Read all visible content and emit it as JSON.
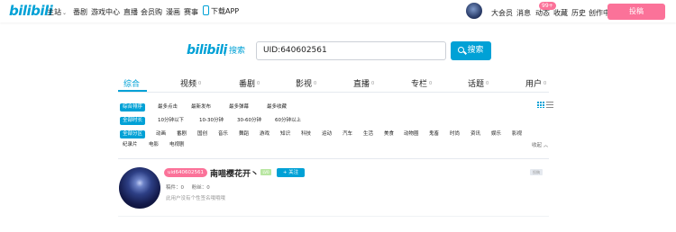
{
  "header": {
    "logo": "bilibili",
    "nav": [
      {
        "label": "主站",
        "has_chevron": true
      },
      {
        "label": "番剧"
      },
      {
        "label": "游戏中心"
      },
      {
        "label": "直播"
      },
      {
        "label": "会员购"
      },
      {
        "label": "漫画"
      },
      {
        "label": "赛事"
      },
      {
        "label": "下载APP"
      }
    ],
    "right": [
      {
        "label": "大会员"
      },
      {
        "label": "消息"
      },
      {
        "label": "动态"
      },
      {
        "label": "收藏"
      },
      {
        "label": "历史"
      },
      {
        "label": "创作中心"
      }
    ],
    "dynamic_badge": "99+",
    "upload_label": "投稿"
  },
  "search": {
    "logo": "bilibili",
    "logo_sub": "搜索",
    "query": "UID:640602561",
    "button_label": "搜索"
  },
  "tabs": [
    {
      "label": "综合",
      "count": "",
      "active": true
    },
    {
      "label": "视频",
      "count": "0"
    },
    {
      "label": "番剧",
      "count": "0"
    },
    {
      "label": "影视",
      "count": "0"
    },
    {
      "label": "直播",
      "count": "0"
    },
    {
      "label": "专栏",
      "count": "0"
    },
    {
      "label": "话题",
      "count": "0"
    },
    {
      "label": "用户",
      "count": "0"
    }
  ],
  "filters": {
    "order": [
      "综合排序",
      "最多点击",
      "最新发布",
      "最多弹幕",
      "最多收藏"
    ],
    "duration": [
      "全部时长",
      "10分钟以下",
      "10-30分钟",
      "30-60分钟",
      "60分钟以上"
    ],
    "zones_row1": [
      "全部分区",
      "动画",
      "番剧",
      "国创",
      "音乐",
      "舞蹈",
      "游戏",
      "知识",
      "科技",
      "运动",
      "汽车",
      "生活",
      "美食",
      "动物圈",
      "鬼畜",
      "时尚",
      "资讯",
      "娱乐",
      "影视"
    ],
    "zones_row2": [
      "纪录片",
      "电影",
      "电视剧"
    ],
    "collapse_label": "收起"
  },
  "result": {
    "uid_tag": "uid640602561",
    "name": "南喵樱花开丶",
    "level": "LV0",
    "follow_label": "+ 关注",
    "stats": [
      "稿件：0",
      "粉丝：0"
    ],
    "sign": "此用户没有个性签名哦哦哦",
    "corner_label": "投稿"
  },
  "colors": {
    "accent": "#00a1d6",
    "pink": "#fb7299"
  }
}
